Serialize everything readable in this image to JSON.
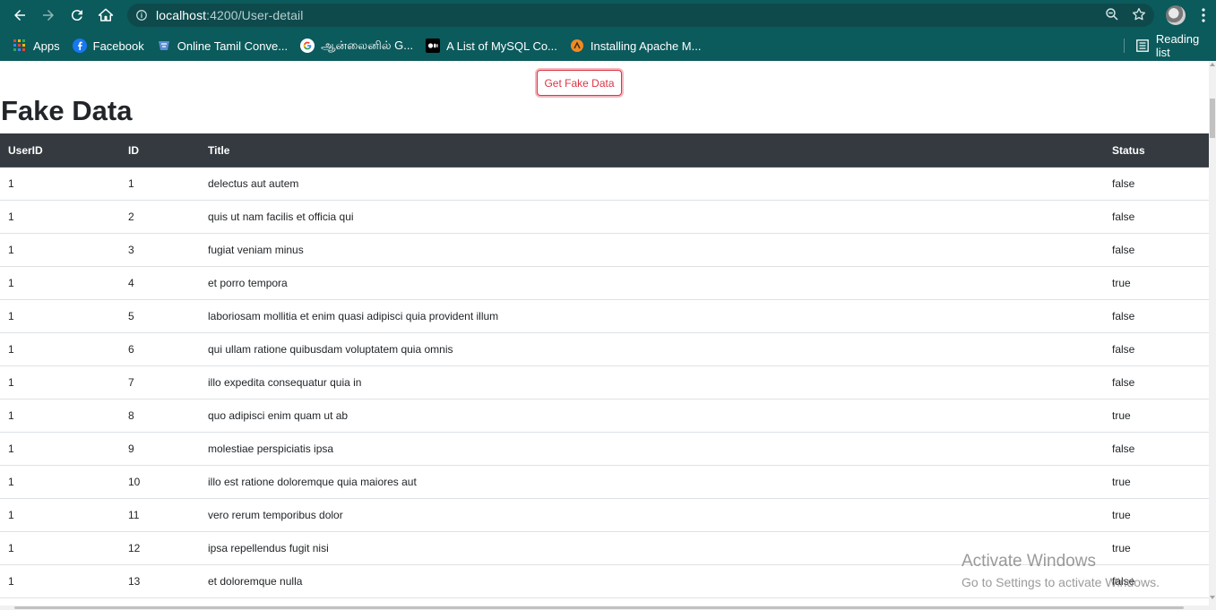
{
  "browser": {
    "url_host": "localhost",
    "url_path": ":4200/User-detail",
    "bookmarks": [
      {
        "label": "Apps",
        "icon": "apps-grid-icon"
      },
      {
        "label": "Facebook",
        "icon": "facebook-icon"
      },
      {
        "label": "Online Tamil Conve...",
        "icon": "tamil-converter-icon"
      },
      {
        "label": "ஆன்லைனில் G...",
        "icon": "google-icon"
      },
      {
        "label": "A List of MySQL Co...",
        "icon": "medium-icon"
      },
      {
        "label": "Installing Apache M...",
        "icon": "apache-icon"
      }
    ],
    "reading_list": "Reading list"
  },
  "page": {
    "button_label": "Get Fake Data",
    "title": "Fake Data"
  },
  "table": {
    "headers": [
      "UserID",
      "ID",
      "Title",
      "Status"
    ],
    "rows": [
      [
        "1",
        "1",
        "delectus aut autem",
        "false"
      ],
      [
        "1",
        "2",
        "quis ut nam facilis et officia qui",
        "false"
      ],
      [
        "1",
        "3",
        "fugiat veniam minus",
        "false"
      ],
      [
        "1",
        "4",
        "et porro tempora",
        "true"
      ],
      [
        "1",
        "5",
        "laboriosam mollitia et enim quasi adipisci quia provident illum",
        "false"
      ],
      [
        "1",
        "6",
        "qui ullam ratione quibusdam voluptatem quia omnis",
        "false"
      ],
      [
        "1",
        "7",
        "illo expedita consequatur quia in",
        "false"
      ],
      [
        "1",
        "8",
        "quo adipisci enim quam ut ab",
        "true"
      ],
      [
        "1",
        "9",
        "molestiae perspiciatis ipsa",
        "false"
      ],
      [
        "1",
        "10",
        "illo est ratione doloremque quia maiores aut",
        "true"
      ],
      [
        "1",
        "11",
        "vero rerum temporibus dolor",
        "true"
      ],
      [
        "1",
        "12",
        "ipsa repellendus fugit nisi",
        "true"
      ],
      [
        "1",
        "13",
        "et doloremque nulla",
        "false"
      ]
    ]
  },
  "watermark": {
    "title": "Activate Windows",
    "subtitle": "Go to Settings to activate Windows."
  },
  "colors": {
    "chrome": "#0b5a5c",
    "table_header": "#343a40",
    "button_accent": "#dc3545"
  }
}
